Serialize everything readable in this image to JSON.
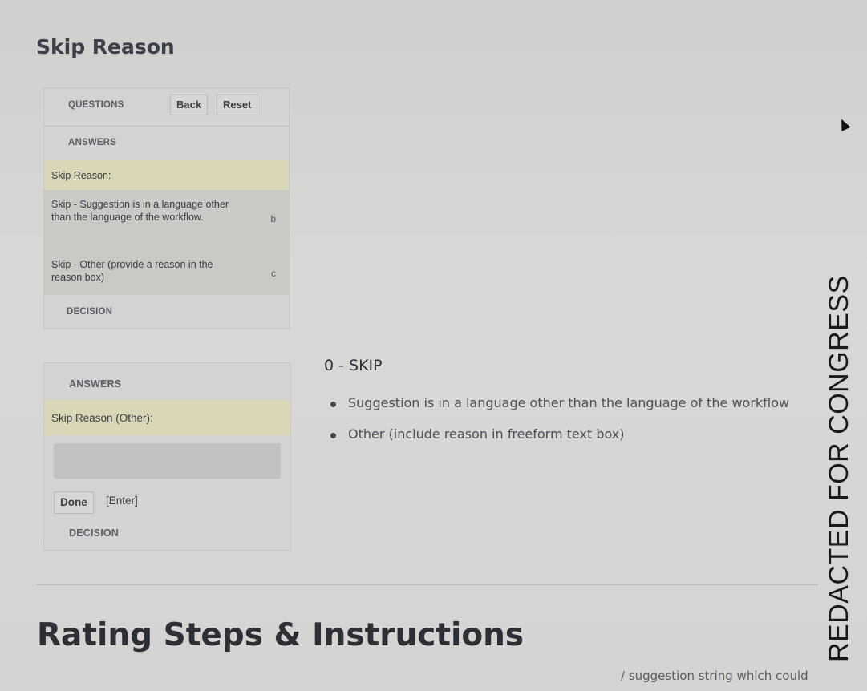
{
  "page": {
    "title": "Skip Reason"
  },
  "panel1": {
    "questions_header": "QUESTIONS",
    "back_label": "Back",
    "reset_label": "Reset",
    "answers_header": "ANSWERS",
    "skip_reason_label": "Skip Reason:",
    "options": [
      {
        "text": "Skip - Suggestion is in a language other than the language of the workflow.",
        "key": "b"
      },
      {
        "text": "Skip - Other (provide a reason in the reason box)",
        "key": "c"
      }
    ],
    "decision_header": "DECISION"
  },
  "panel2": {
    "answers_header": "ANSWERS",
    "skip_reason_other_label": "Skip Reason (Other):",
    "reason_input_value": "",
    "done_label": "Done",
    "done_hint": "[Enter]",
    "decision_header": "DECISION"
  },
  "content": {
    "skip_heading": "0 - SKIP",
    "bullets": [
      "Suggestion is in a language other than the language of the workflow",
      "Other (include reason in freeform text box)"
    ]
  },
  "section": {
    "rating_heading": "Rating Steps & Instructions",
    "cut_text": "/ suggestion string which could"
  },
  "overlay": {
    "redacted_text": "REDACTED FOR CONGRESS"
  }
}
